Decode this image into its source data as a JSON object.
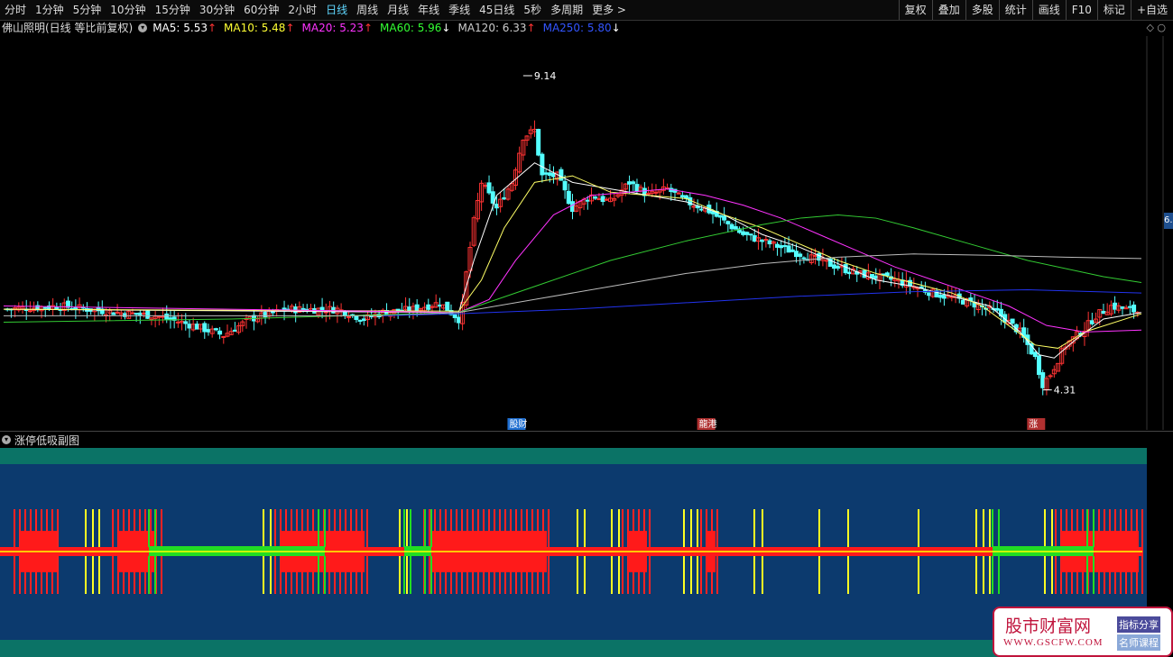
{
  "toolbar": {
    "timeframes": [
      "分时",
      "1分钟",
      "5分钟",
      "10分钟",
      "15分钟",
      "30分钟",
      "60分钟",
      "2小时",
      "日线",
      "周线",
      "月线",
      "年线",
      "季线",
      "45日线",
      "5秒",
      "多周期",
      "更多 >"
    ],
    "active": "日线",
    "tools": [
      "复权",
      "叠加",
      "多股",
      "统计",
      "画线",
      "F10",
      "标记",
      "+自选"
    ]
  },
  "info": {
    "stock_title": "佛山照明(日线 等比前复权)",
    "ma": [
      {
        "label": "MA5: 5.53",
        "arrow": "↑",
        "color": "#ffffff",
        "arrow_color": "#ff3333"
      },
      {
        "label": "MA10: 5.48",
        "arrow": "↑",
        "color": "#ffff33",
        "arrow_color": "#ff3333"
      },
      {
        "label": "MA20: 5.23",
        "arrow": "↑",
        "color": "#ff33ff",
        "arrow_color": "#ff3333"
      },
      {
        "label": "MA60: 5.96",
        "arrow": "↓",
        "color": "#33ff33",
        "arrow_color": "#ffffff"
      },
      {
        "label": "MA120: 6.33",
        "arrow": "↑",
        "color": "#cccccc",
        "arrow_color": "#ff3333"
      },
      {
        "label": "MA250: 5.80",
        "arrow": "↓",
        "color": "#3355ff",
        "arrow_color": "#ffffff"
      }
    ],
    "icons": "◇ ○"
  },
  "annotations": {
    "high": "9.14",
    "low": "4.31",
    "tags": [
      {
        "text": "股财",
        "color": "#1f6fd1"
      },
      {
        "text": "龍港",
        "color": "#b03030"
      },
      {
        "text": "涨",
        "color": "#b03030"
      }
    ]
  },
  "right_axis": "6.",
  "sub": {
    "title": "涨停低吸副图"
  },
  "watermark": {
    "title": "股市财富网",
    "url": "WWW.GSCFW.COM",
    "badge1": "指标分享",
    "badge2": "名师课程"
  },
  "colors": {
    "up": "#ff3333",
    "down": "#54ffff",
    "ma5": "#ffffff",
    "ma10": "#ffff66",
    "ma20": "#ff33ff",
    "ma60": "#33cc33",
    "ma120": "#bbbbbb",
    "ma250": "#2233ee",
    "sub_bg": "#0c3a6e",
    "sub_band": "#0b7366"
  },
  "chart_data": {
    "type": "candlestick",
    "ylim": [
      4.0,
      9.5
    ],
    "price_path": [
      [
        0,
        5.55
      ],
      [
        15,
        5.6
      ],
      [
        30,
        5.5
      ],
      [
        40,
        5.45
      ],
      [
        50,
        5.3
      ],
      [
        58,
        5.15
      ],
      [
        65,
        5.4
      ],
      [
        75,
        5.55
      ],
      [
        88,
        5.55
      ],
      [
        95,
        5.4
      ],
      [
        100,
        5.5
      ],
      [
        108,
        5.55
      ],
      [
        115,
        5.65
      ],
      [
        120,
        5.4
      ],
      [
        121,
        5.6
      ],
      [
        122,
        6.1
      ],
      [
        124,
        6.9
      ],
      [
        126,
        7.5
      ],
      [
        130,
        7.1
      ],
      [
        134,
        7.5
      ],
      [
        137,
        8.2
      ],
      [
        140,
        8.3
      ],
      [
        142,
        7.6
      ],
      [
        146,
        7.6
      ],
      [
        150,
        7.1
      ],
      [
        155,
        7.3
      ],
      [
        160,
        7.2
      ],
      [
        165,
        7.5
      ],
      [
        170,
        7.3
      ],
      [
        175,
        7.4
      ],
      [
        180,
        7.2
      ],
      [
        185,
        7.1
      ],
      [
        195,
        6.7
      ],
      [
        205,
        6.5
      ],
      [
        215,
        6.3
      ],
      [
        225,
        6.1
      ],
      [
        235,
        6.0
      ],
      [
        245,
        5.8
      ],
      [
        255,
        5.65
      ],
      [
        262,
        5.5
      ],
      [
        268,
        5.2
      ],
      [
        272,
        4.8
      ],
      [
        274,
        4.4
      ],
      [
        276,
        4.55
      ],
      [
        280,
        5.0
      ],
      [
        285,
        5.25
      ],
      [
        288,
        5.45
      ],
      [
        292,
        5.6
      ],
      [
        300,
        5.5
      ]
    ],
    "ma": {
      "ma5": [
        [
          0,
          5.55
        ],
        [
          120,
          5.5
        ],
        [
          124,
          6.3
        ],
        [
          130,
          7.3
        ],
        [
          140,
          7.8
        ],
        [
          150,
          7.5
        ],
        [
          160,
          7.4
        ],
        [
          170,
          7.3
        ],
        [
          180,
          7.2
        ],
        [
          190,
          7.0
        ],
        [
          200,
          6.7
        ],
        [
          210,
          6.5
        ],
        [
          220,
          6.25
        ],
        [
          230,
          6.0
        ],
        [
          240,
          5.9
        ],
        [
          250,
          5.75
        ],
        [
          260,
          5.6
        ],
        [
          268,
          5.2
        ],
        [
          273,
          4.85
        ],
        [
          277,
          4.8
        ],
        [
          283,
          5.1
        ],
        [
          290,
          5.4
        ],
        [
          300,
          5.5
        ]
      ],
      "ma10": [
        [
          0,
          5.55
        ],
        [
          120,
          5.52
        ],
        [
          126,
          6.0
        ],
        [
          132,
          6.8
        ],
        [
          140,
          7.5
        ],
        [
          150,
          7.6
        ],
        [
          160,
          7.35
        ],
        [
          170,
          7.3
        ],
        [
          180,
          7.25
        ],
        [
          190,
          7.0
        ],
        [
          200,
          6.8
        ],
        [
          210,
          6.55
        ],
        [
          220,
          6.3
        ],
        [
          230,
          6.1
        ],
        [
          240,
          5.95
        ],
        [
          250,
          5.8
        ],
        [
          258,
          5.6
        ],
        [
          265,
          5.3
        ],
        [
          272,
          5.0
        ],
        [
          278,
          4.95
        ],
        [
          285,
          5.2
        ],
        [
          300,
          5.48
        ]
      ],
      "ma20": [
        [
          0,
          5.6
        ],
        [
          120,
          5.5
        ],
        [
          128,
          5.7
        ],
        [
          135,
          6.3
        ],
        [
          145,
          7.0
        ],
        [
          155,
          7.3
        ],
        [
          165,
          7.35
        ],
        [
          175,
          7.4
        ],
        [
          185,
          7.3
        ],
        [
          195,
          7.15
        ],
        [
          205,
          6.95
        ],
        [
          215,
          6.7
        ],
        [
          225,
          6.45
        ],
        [
          235,
          6.2
        ],
        [
          245,
          6.0
        ],
        [
          255,
          5.8
        ],
        [
          265,
          5.6
        ],
        [
          275,
          5.3
        ],
        [
          285,
          5.2
        ],
        [
          300,
          5.23
        ]
      ],
      "ma60": [
        [
          0,
          5.35
        ],
        [
          60,
          5.4
        ],
        [
          120,
          5.5
        ],
        [
          140,
          5.9
        ],
        [
          160,
          6.3
        ],
        [
          180,
          6.6
        ],
        [
          200,
          6.85
        ],
        [
          210,
          6.95
        ],
        [
          220,
          7.0
        ],
        [
          230,
          6.95
        ],
        [
          240,
          6.8
        ],
        [
          255,
          6.55
        ],
        [
          270,
          6.3
        ],
        [
          290,
          6.05
        ],
        [
          300,
          5.96
        ]
      ],
      "ma120": [
        [
          0,
          5.45
        ],
        [
          100,
          5.45
        ],
        [
          120,
          5.5
        ],
        [
          140,
          5.7
        ],
        [
          160,
          5.9
        ],
        [
          180,
          6.1
        ],
        [
          200,
          6.25
        ],
        [
          220,
          6.35
        ],
        [
          240,
          6.4
        ],
        [
          260,
          6.38
        ],
        [
          280,
          6.35
        ],
        [
          300,
          6.33
        ]
      ],
      "ma250": [
        [
          100,
          5.45
        ],
        [
          120,
          5.48
        ],
        [
          150,
          5.55
        ],
        [
          180,
          5.65
        ],
        [
          210,
          5.75
        ],
        [
          240,
          5.82
        ],
        [
          270,
          5.85
        ],
        [
          300,
          5.8
        ]
      ]
    },
    "sub_segments": {
      "red": [
        [
          16,
          69
        ],
        [
          125,
          180
        ],
        [
          305,
          410
        ],
        [
          470,
          612
        ],
        [
          690,
          723
        ],
        [
          777,
          795
        ],
        [
          1170,
          1268
        ]
      ],
      "green": [
        [
          165,
          360
        ],
        [
          448,
          478
        ],
        [
          1100,
          1212
        ]
      ],
      "yellow_bars": [
        95,
        103,
        110,
        292,
        300,
        443,
        451,
        640,
        648,
        678,
        686,
        758,
        766,
        773,
        836,
        845,
        908,
        940,
        1018,
        1082,
        1090,
        1097,
        1158,
        1166
      ]
    }
  }
}
